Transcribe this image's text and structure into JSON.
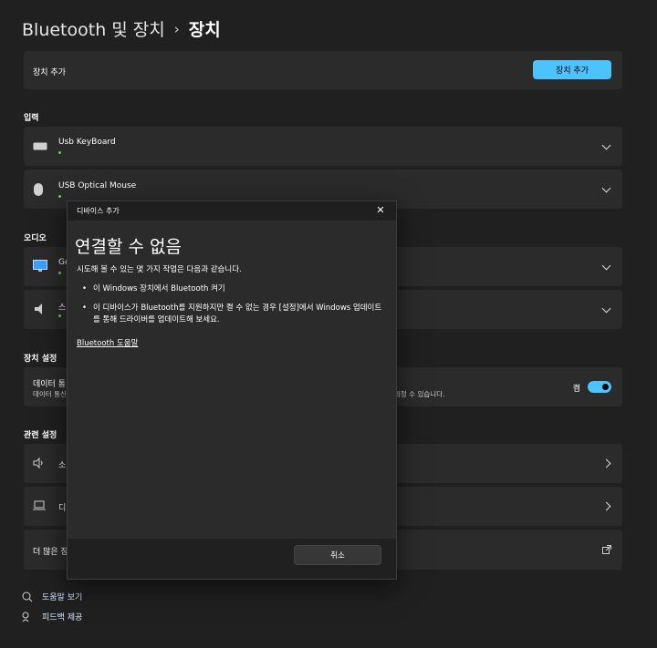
{
  "header": {
    "parent": "Bluetooth 및 장치",
    "separator": "›",
    "current": "장치"
  },
  "add_device_row": {
    "label": "장치 추가",
    "button": "장치 추가"
  },
  "sections": {
    "input": "입력",
    "audio": "오디오",
    "device_settings": "장치 설정",
    "related_settings": "관련 설정"
  },
  "input_devices": [
    {
      "name": "Usb KeyBoard",
      "icon": "keyboard-icon"
    },
    {
      "name": "USB Optical Mouse",
      "icon": "mouse-icon"
    }
  ],
  "audio_devices": [
    {
      "name": "Ge",
      "icon": "monitor-icon"
    },
    {
      "name": "스",
      "icon": "speaker-icon"
    }
  ],
  "device_setting_row": {
    "title": "데이터 통",
    "subtitle_left": "데이터 통신",
    "subtitle_right": "과정 수 있습니다.",
    "toggle_label": "켬",
    "toggle_on": true
  },
  "related_rows": [
    {
      "label": "소",
      "icon": "sound-icon"
    },
    {
      "label": "디",
      "icon": "laptop-icon"
    },
    {
      "label": "더 많은 장",
      "icon": "external-link-icon"
    }
  ],
  "footer_links": [
    {
      "label": "도움말 보기",
      "icon": "help-icon"
    },
    {
      "label": "피드백 제공",
      "icon": "feedback-icon"
    }
  ],
  "dialog": {
    "window_title": "디바이스 추가",
    "heading": "연결할 수 없음",
    "description": "시도해 볼 수 있는 몇 가지 작업은 다음과 같습니다.",
    "bullets": [
      "이 Windows 장치에서 Bluetooth 켜기",
      "이 디바이스가 Bluetooth를 지원하지만 켤 수 없는 경우 [설정]에서 Windows 업데이트를 통해 드라이버를 업데이트해 보세요."
    ],
    "help_link": "Bluetooth 도움말",
    "cancel_button": "취소"
  },
  "colors": {
    "background": "#202020",
    "card": "#2b2b2b",
    "accent": "#4cc2ff",
    "status_green": "#6ccb5f"
  }
}
